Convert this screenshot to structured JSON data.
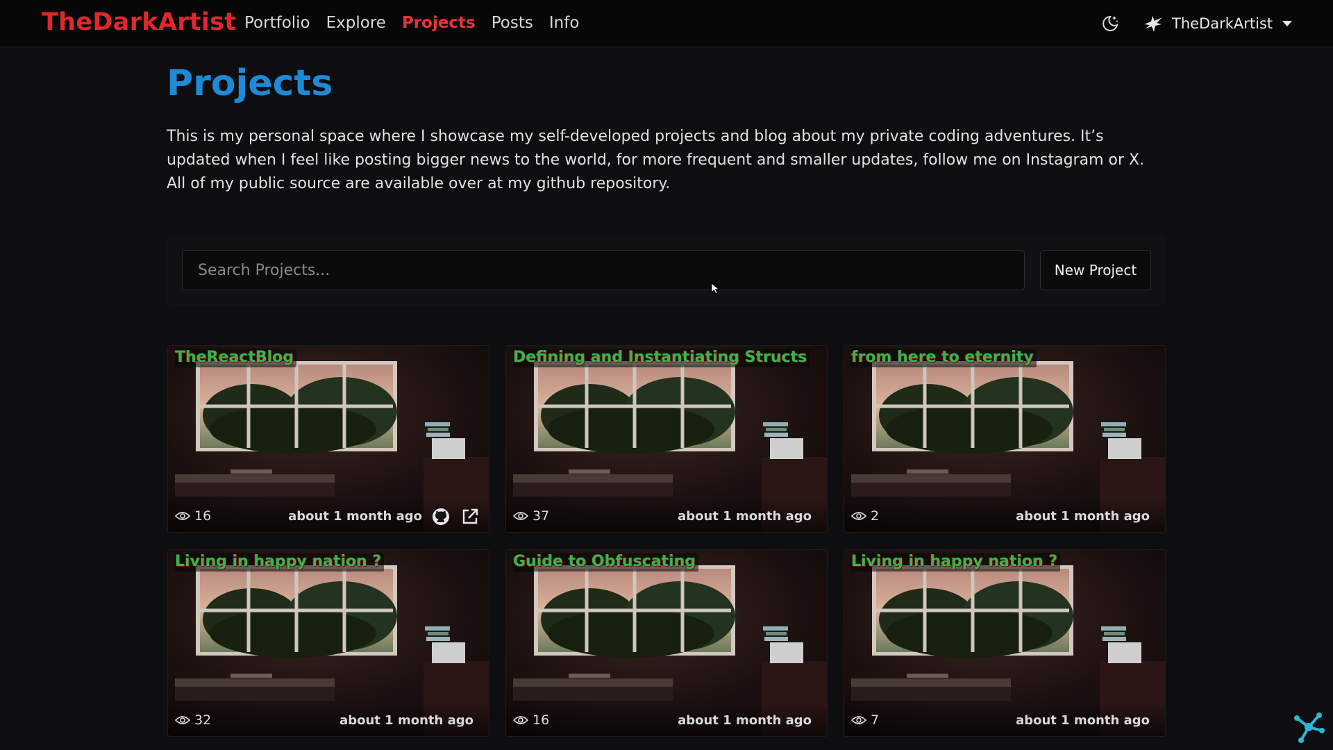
{
  "header": {
    "brand": "TheDarkArtist",
    "nav": [
      {
        "label": "Portfolio",
        "active": false
      },
      {
        "label": "Explore",
        "active": false
      },
      {
        "label": "Projects",
        "active": true
      },
      {
        "label": "Posts",
        "active": false
      },
      {
        "label": "Info",
        "active": false
      }
    ],
    "theme_icon": "moon-star-icon",
    "user": {
      "name": "TheDarkArtist",
      "avatar_icon": "bird-logo-icon"
    }
  },
  "main": {
    "title": "Projects",
    "intro": "This is my personal space where I showcase my self-developed projects and blog about my private coding adventures. It’s updated when I feel like posting bigger news to the world, for more frequent and smaller updates, follow me on Instagram or X. All of my public source are available over at my github repository.",
    "search": {
      "placeholder": "Search Projects...",
      "value": ""
    },
    "new_button": "New Project"
  },
  "cards": [
    {
      "title": "TheReactBlog",
      "views": "16",
      "date": "about 1 month ago",
      "github": true,
      "external_link": true
    },
    {
      "title": "Defining and Instantiating Structs",
      "views": "37",
      "date": "about 1 month ago"
    },
    {
      "title": "from here to eternity",
      "views": "2",
      "date": "about 1 month ago"
    },
    {
      "title": "Living in happy nation ?",
      "views": "32",
      "date": "about 1 month ago"
    },
    {
      "title": "Guide to Obfuscating",
      "views": "16",
      "date": "about 1 month ago"
    },
    {
      "title": "Living in happy nation ?",
      "views": "7",
      "date": "about 1 month ago"
    }
  ],
  "colors": {
    "brand": "#e0282c",
    "nav_active": "#e8343c",
    "title": "#1d8ad6",
    "card_title": "#33b84d",
    "background": "#0e0e10"
  }
}
